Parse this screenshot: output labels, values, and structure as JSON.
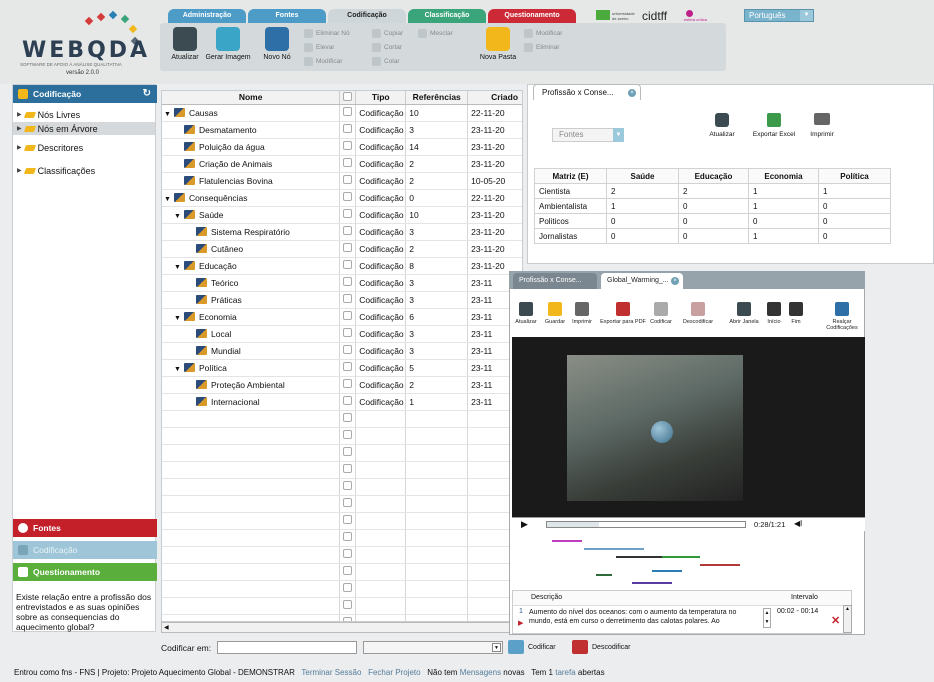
{
  "header": {
    "logo_text": "WEBQDA",
    "logo_tagline": "SOFTWARE DE APOIO À ANÁLISE QUALITATIVA",
    "version": "versão 2.0.0",
    "tabs": [
      {
        "label": "Administração",
        "color": "#4d9cc7"
      },
      {
        "label": "Fontes",
        "color": "#4d9cc7"
      },
      {
        "label": "Codificação",
        "color": "#cfd6da"
      },
      {
        "label": "Classificação",
        "color": "#3aa57a"
      },
      {
        "label": "Questionamento",
        "color": "#cc2a36"
      }
    ],
    "toolbar": {
      "atualizar": "Atualizar",
      "gerar_imagem": "Gerar Imagem",
      "novo_no": "Novo Nó",
      "eliminar_no": "Eliminar Nó",
      "elevar": "Elevar",
      "modificar": "Modificar",
      "copiar": "Copiar",
      "cortar": "Cortar",
      "colar": "Colar",
      "mesclar": "Mesclar",
      "nova_pasta": "Nova Pasta",
      "modificar2": "Modificar",
      "eliminar": "Eliminar"
    },
    "partners": {
      "uni": "universidade de aveiro",
      "cidtff": "cidtff",
      "esfera": "esfera crítica"
    },
    "language": "Português"
  },
  "left_panel": {
    "codificacao_title": "Codificação",
    "tree": [
      "Nós Livres",
      "Nós em Árvore",
      "Descritores",
      "Classificações"
    ],
    "fontes": "Fontes",
    "codificacao2": "Codificação",
    "questionamento": "Questionamento",
    "question_text": "Existe relação entre a profissão dos entrevistados e as suas opiniões sobre as consequencias do aquecimento global?"
  },
  "grid": {
    "columns": [
      "Nome",
      "",
      "Tipo",
      "Referências",
      "Criado"
    ],
    "rows": [
      {
        "name": "Causas",
        "level": 0,
        "expand": true,
        "tipo": "Codificação",
        "ref": "10",
        "date": "22-11-20"
      },
      {
        "name": "Desmatamento",
        "level": 1,
        "expand": false,
        "tipo": "Codificação",
        "ref": "3",
        "date": "23-11-20"
      },
      {
        "name": "Poluição da água",
        "level": 1,
        "expand": false,
        "tipo": "Codificação",
        "ref": "14",
        "date": "23-11-20"
      },
      {
        "name": "Criação de Animais",
        "level": 1,
        "expand": false,
        "tipo": "Codificação",
        "ref": "2",
        "date": "23-11-20"
      },
      {
        "name": "Flatulencias Bovina",
        "level": 1,
        "expand": false,
        "tipo": "Codificação",
        "ref": "2",
        "date": "10-05-20"
      },
      {
        "name": "Consequências",
        "level": 0,
        "expand": true,
        "tipo": "Codificação",
        "ref": "0",
        "date": "22-11-20"
      },
      {
        "name": "Saúde",
        "level": 1,
        "expand": true,
        "tipo": "Codificação",
        "ref": "10",
        "date": "23-11-20"
      },
      {
        "name": "Sistema Respiratório",
        "level": 2,
        "expand": false,
        "tipo": "Codificação",
        "ref": "3",
        "date": "23-11-20"
      },
      {
        "name": "Cutâneo",
        "level": 2,
        "expand": false,
        "tipo": "Codificação",
        "ref": "2",
        "date": "23-11-20"
      },
      {
        "name": "Educação",
        "level": 1,
        "expand": true,
        "tipo": "Codificação",
        "ref": "8",
        "date": "23-11-20"
      },
      {
        "name": "Teórico",
        "level": 2,
        "expand": false,
        "tipo": "Codificação",
        "ref": "3",
        "date": "23-11"
      },
      {
        "name": "Práticas",
        "level": 2,
        "expand": false,
        "tipo": "Codificação",
        "ref": "3",
        "date": "23-11"
      },
      {
        "name": "Economia",
        "level": 1,
        "expand": true,
        "tipo": "Codificação",
        "ref": "6",
        "date": "23-11"
      },
      {
        "name": "Local",
        "level": 2,
        "expand": false,
        "tipo": "Codificação",
        "ref": "3",
        "date": "23-11"
      },
      {
        "name": "Mundial",
        "level": 2,
        "expand": false,
        "tipo": "Codificação",
        "ref": "3",
        "date": "23-11"
      },
      {
        "name": "Política",
        "level": 1,
        "expand": true,
        "tipo": "Codificação",
        "ref": "5",
        "date": "23-11"
      },
      {
        "name": "Proteção Ambiental",
        "level": 2,
        "expand": false,
        "tipo": "Codificação",
        "ref": "2",
        "date": "23-11"
      },
      {
        "name": "Internacional",
        "level": 2,
        "expand": false,
        "tipo": "Codificação",
        "ref": "1",
        "date": "23-11"
      }
    ],
    "empty_rows": 13
  },
  "codebar": {
    "label": "Codificar em:",
    "codificar": "Codificar",
    "descodificar": "Descodificar"
  },
  "status": {
    "prefix": "Entrou como fns - FNS | Projeto: Projeto Aquecimento Global - DEMONSTRAR",
    "terminar": "Terminar Sessão",
    "fechar": "Fechar Projeto",
    "nao_tem": "Não tem",
    "mensagens": "Mensagens",
    "novas": "novas",
    "tem": "Tem 1",
    "tarefa": "tarefa",
    "abertas": "abertas"
  },
  "matrix_window": {
    "tab": "Profissão x Conse...",
    "fontes": "Fontes",
    "atualizar": "Atualizar",
    "exportar": "Exportar Excel",
    "imprimir": "Imprimir",
    "headers": [
      "Matriz (E)",
      "Saúde",
      "Educação",
      "Economia",
      "Política"
    ],
    "rows": [
      [
        "Cientista",
        "2",
        "2",
        "1",
        "1"
      ],
      [
        "Ambientalista",
        "1",
        "0",
        "1",
        "0"
      ],
      [
        "Politicos",
        "0",
        "0",
        "0",
        "0"
      ],
      [
        "Jornalistas",
        "0",
        "0",
        "1",
        "0"
      ]
    ]
  },
  "video_window": {
    "tab1": "Profissão x Conse...",
    "tab2": "Global_Warming_...",
    "buttons": [
      "Atualizar",
      "Guardar",
      "Imprimir",
      "Exportar para PDF",
      "Codificar",
      "Descodificar",
      "Abrir Janela",
      "Início",
      "Fim",
      "Realçar Codificações"
    ],
    "time": "0:28/1:21",
    "desc_header": "Descrição",
    "interval_header": "Intervalo",
    "row_num": "1",
    "row_desc": "Aumento do nível dos oceanos: com o aumento da temperatura no mundo, está em curso o derretimento das calotas polares. Ao",
    "row_interval": "00:02 - 00:14",
    "progress": 0.26
  }
}
